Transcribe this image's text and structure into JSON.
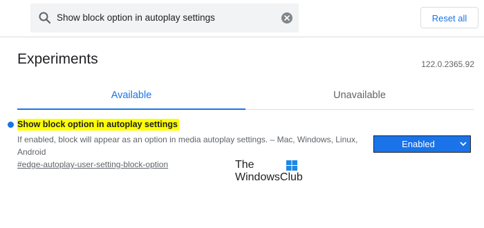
{
  "search": {
    "query": "Show block option in autoplay settings",
    "icon": "search-icon",
    "clear_icon": "clear-icon"
  },
  "header": {
    "reset_label": "Reset all",
    "title": "Experiments",
    "version": "122.0.2365.92"
  },
  "tabs": [
    {
      "label": "Available",
      "active": true
    },
    {
      "label": "Unavailable",
      "active": false
    }
  ],
  "flag": {
    "name": "Show block option in autoplay settings",
    "description": "If enabled, block will appear as an option in media autoplay settings. – Mac, Windows, Linux, Android",
    "link": "#edge-autoplay-user-setting-block-option",
    "selected_option": "Enabled"
  },
  "watermark": {
    "line1": "The",
    "line2": "WindowsClub"
  },
  "colors": {
    "accent": "#1a73e8",
    "highlight": "#ffff00",
    "text_secondary": "#5f6368"
  }
}
